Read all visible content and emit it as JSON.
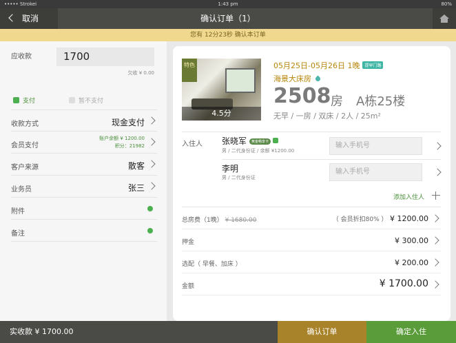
{
  "status": {
    "carrier": "••••• Strokei",
    "time": "1:43 pm",
    "battery": "80%"
  },
  "nav": {
    "back_label": "取消",
    "title": "确认订单（1）"
  },
  "banner": {
    "text": "您有 12分23秒 确认本订单"
  },
  "left": {
    "receivable_label": "应收款",
    "receivable_value": "1700",
    "owed": "欠收 ¥ 0.00",
    "pay_option": "支付",
    "nopay_option": "暂不支付",
    "pay_method_label": "收款方式",
    "pay_method_value": "现金支付",
    "member_pay_label": "会员支付",
    "member_balance": "账户余额 ¥ 1200.00",
    "member_points": "积分：21982",
    "source_label": "客户来源",
    "source_value": "散客",
    "staff_label": "业务员",
    "staff_value": "张三",
    "attach_label": "附件",
    "note_label": "备注"
  },
  "room": {
    "photo_tag": "特色",
    "score": "4.5分",
    "dates": "05月25日-05月26日",
    "nights": "1晚",
    "badge": "提早门路",
    "type": "海景大床房",
    "number": "2508",
    "number_suffix": "房",
    "building": "A栋25楼",
    "specs": "无早 / 一房 / 双床 / 2人 / 25m²"
  },
  "guests": {
    "label": "入住人",
    "phone_placeholder": "输入手机号",
    "list": [
      {
        "name": "张晓军",
        "vip": "黄金畅享卡",
        "sub": "男 / 二代身份证 / 余额 ¥1200.00"
      },
      {
        "name": "李明",
        "sub": "男 / 二代身份证"
      }
    ],
    "add_label": "添加入住人"
  },
  "fees": {
    "room_label": "总房费（1晚）",
    "room_original": "¥ 1680.00",
    "room_discount": "（ 会员折扣80% ）",
    "room_value": "¥ 1200.00",
    "deposit_label": "押金",
    "deposit_value": "¥ 300.00",
    "extras_label": "选配（ 早餐、加床 ）",
    "extras_value": "¥ 200.00",
    "total_label": "金额",
    "total_value": "¥ 1700.00"
  },
  "bottom": {
    "paid": "实收款 ¥ 1700.00",
    "confirm": "确认订单",
    "checkin": "确定入住"
  }
}
